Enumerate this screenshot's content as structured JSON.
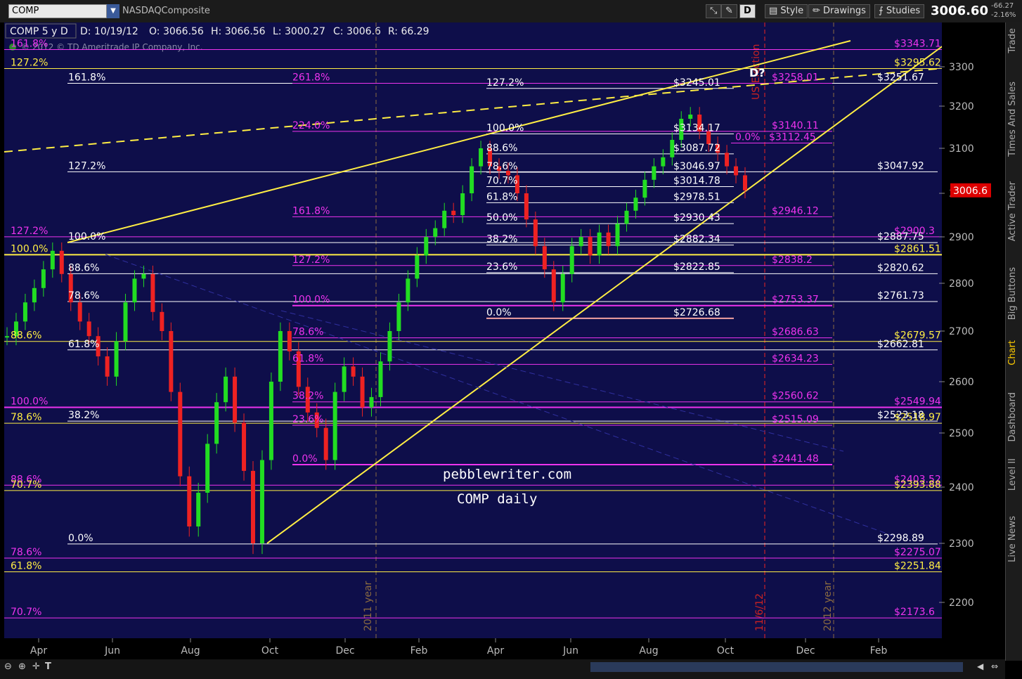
{
  "header": {
    "symbol": "COMP",
    "description": "NASDAQComposite",
    "period_button": "D",
    "style_label": "Style",
    "drawings_label": "Drawings",
    "studies_label": "Studies",
    "last": "3006.60",
    "change": "-66.27",
    "change_pct": "-2.16%"
  },
  "sidebar": {
    "tabs": [
      "Trade",
      "Times And Sales",
      "Active Trader",
      "Big Buttons",
      "Chart",
      "Dashboard",
      "Level II",
      "Live News"
    ]
  },
  "chart_data": {
    "type": "candlestick",
    "info_symbol": "COMP 5 y D",
    "info_fields": [
      "D: 10/19/12",
      "O: 3066.56",
      "H: 3066.56",
      "L: 3000.27",
      "C: 3006.6",
      "R: 66.29"
    ],
    "copyright": "© 2012 © TD Ameritrade IP Company, Inc.",
    "watermark": [
      "pebblewriter.com",
      "COMP daily"
    ],
    "price_label": "3006.6",
    "yaxis_ticks": [
      3300,
      3200,
      3100,
      3000,
      2900,
      2800,
      2700,
      2600,
      2500,
      2400,
      2300,
      2200
    ],
    "xaxis_ticks": [
      "Apr",
      "Jun",
      "Aug",
      "Oct",
      "Dec",
      "Feb",
      "Apr",
      "Jun",
      "Aug",
      "Oct",
      "Dec",
      "Feb"
    ],
    "vertical_labels": [
      "2011 year",
      "US Election",
      "11/6/12",
      "2012 year"
    ],
    "points_label": "D?",
    "close_series": [
      2690,
      2720,
      2760,
      2790,
      2830,
      2870,
      2820,
      2760,
      2720,
      2690,
      2650,
      2610,
      2680,
      2760,
      2810,
      2820,
      2740,
      2700,
      2580,
      2420,
      2330,
      2390,
      2480,
      2560,
      2610,
      2520,
      2430,
      2300,
      2450,
      2600,
      2700,
      2660,
      2590,
      2540,
      2510,
      2450,
      2580,
      2630,
      2610,
      2550,
      2570,
      2640,
      2700,
      2760,
      2810,
      2860,
      2900,
      2920,
      2960,
      2950,
      3000,
      3060,
      3100,
      3060,
      3050,
      3040,
      3000,
      2940,
      2880,
      2830,
      2760,
      2820,
      2880,
      2900,
      2860,
      2910,
      2880,
      2930,
      2960,
      2990,
      3030,
      3060,
      3080,
      3120,
      3170,
      3180,
      3140,
      3110,
      3090,
      3060,
      3040,
      3006.6
    ],
    "fib_levels": [
      {
        "text": "161.8%",
        "value": 3258.01
      },
      {
        "text": "127.2%",
        "value": 3047.92
      },
      {
        "text": "100.0%",
        "value": 2887.75
      },
      {
        "text": "88.6%",
        "value": 2820.62
      },
      {
        "text": "78.6%",
        "value": 2761.73
      },
      {
        "text": "61.8%",
        "value": 2662.81
      },
      {
        "text": "38.2%",
        "value": 2523.18
      },
      {
        "text": "0.0%",
        "value": 2298.89
      }
    ],
    "fib_right_labels": [
      "$3251.67",
      "$3047.92",
      "$2887.75",
      "$2820.62",
      "$2761.73",
      "$2662.81",
      "$2523.18",
      "$2298.89"
    ],
    "fib_mid_white": [
      {
        "text": "127.2%",
        "label": "$3245.01"
      },
      {
        "text": "100.0%",
        "label": "$3134.17"
      },
      {
        "text": "88.6%",
        "label": "$3087.72"
      },
      {
        "text": "78.6%",
        "label": "$3046.97"
      },
      {
        "text": "70.7%",
        "label": "$3014.78"
      },
      {
        "text": "61.8%",
        "label": "$2978.51"
      },
      {
        "text": "50.0%",
        "label": "$2930.43"
      },
      {
        "text": "38.2%",
        "label": "$2882.34"
      },
      {
        "text": "23.6%",
        "label": "$2822.85"
      },
      {
        "text": "0.0%",
        "label": "$2726.68"
      }
    ],
    "fib_mid_magenta": [
      {
        "text": "261.8%",
        "label": "$3258.01"
      },
      {
        "text": "224.0%",
        "label": "$3140.11"
      },
      {
        "text": "0.0%",
        "label": "$3112.45"
      },
      {
        "text": "161.8%",
        "label": "$2946.12"
      },
      {
        "text": "127.2%",
        "label": "$2838.2"
      },
      {
        "text": "100.0%",
        "label": "$2753.37"
      },
      {
        "text": "78.6%",
        "label": "$2686.63"
      },
      {
        "text": "61.8%",
        "label": "$2634.23"
      },
      {
        "text": "38.2%",
        "label": "$2560.62"
      },
      {
        "text": "23.6%",
        "label": "$2515.09"
      },
      {
        "text": "0.0%",
        "label": "$2441.48"
      }
    ],
    "fib_left": [
      {
        "text": "161.8%",
        "color": "magenta"
      },
      {
        "text": "127.2%",
        "color": "yellow"
      },
      {
        "text": "127.2%",
        "color": "magenta"
      },
      {
        "text": "100.0%",
        "color": "yellow"
      },
      {
        "text": "88.6%",
        "color": "yellow"
      },
      {
        "text": "100.0%",
        "color": "magenta"
      },
      {
        "text": "78.6%",
        "color": "yellow"
      },
      {
        "text": "88.6%",
        "color": "magenta"
      },
      {
        "text": "70.7%",
        "color": "yellow"
      },
      {
        "text": "78.6%",
        "color": "magenta"
      },
      {
        "text": "61.8%",
        "color": "yellow"
      },
      {
        "text": "70.7%",
        "color": "magenta"
      }
    ],
    "right_labels_extra": [
      {
        "label": "$3343.71",
        "color": "magenta"
      },
      {
        "label": "$3295.62",
        "color": "yellow"
      },
      {
        "label": "$2900.3",
        "color": "magenta"
      },
      {
        "label": "$2861.51",
        "color": "yellow"
      },
      {
        "label": "$2679.57",
        "color": "yellow"
      },
      {
        "label": "$2549.94",
        "color": "magenta"
      },
      {
        "label": "$2518.97",
        "color": "yellow"
      },
      {
        "label": "$2403.52",
        "color": "magenta"
      },
      {
        "label": "$2393.88",
        "color": "yellow"
      },
      {
        "label": "$2275.07",
        "color": "magenta"
      },
      {
        "label": "$2251.84",
        "color": "yellow"
      },
      {
        "label": "$2173.6",
        "color": "magenta"
      }
    ],
    "colors": {
      "background": "#0e0e4a",
      "up": "#22dd22",
      "down": "#ee2222",
      "fib_white": "#ffffff",
      "fib_magenta": "#ee33ee",
      "fib_yellow": "#ffee44"
    }
  }
}
